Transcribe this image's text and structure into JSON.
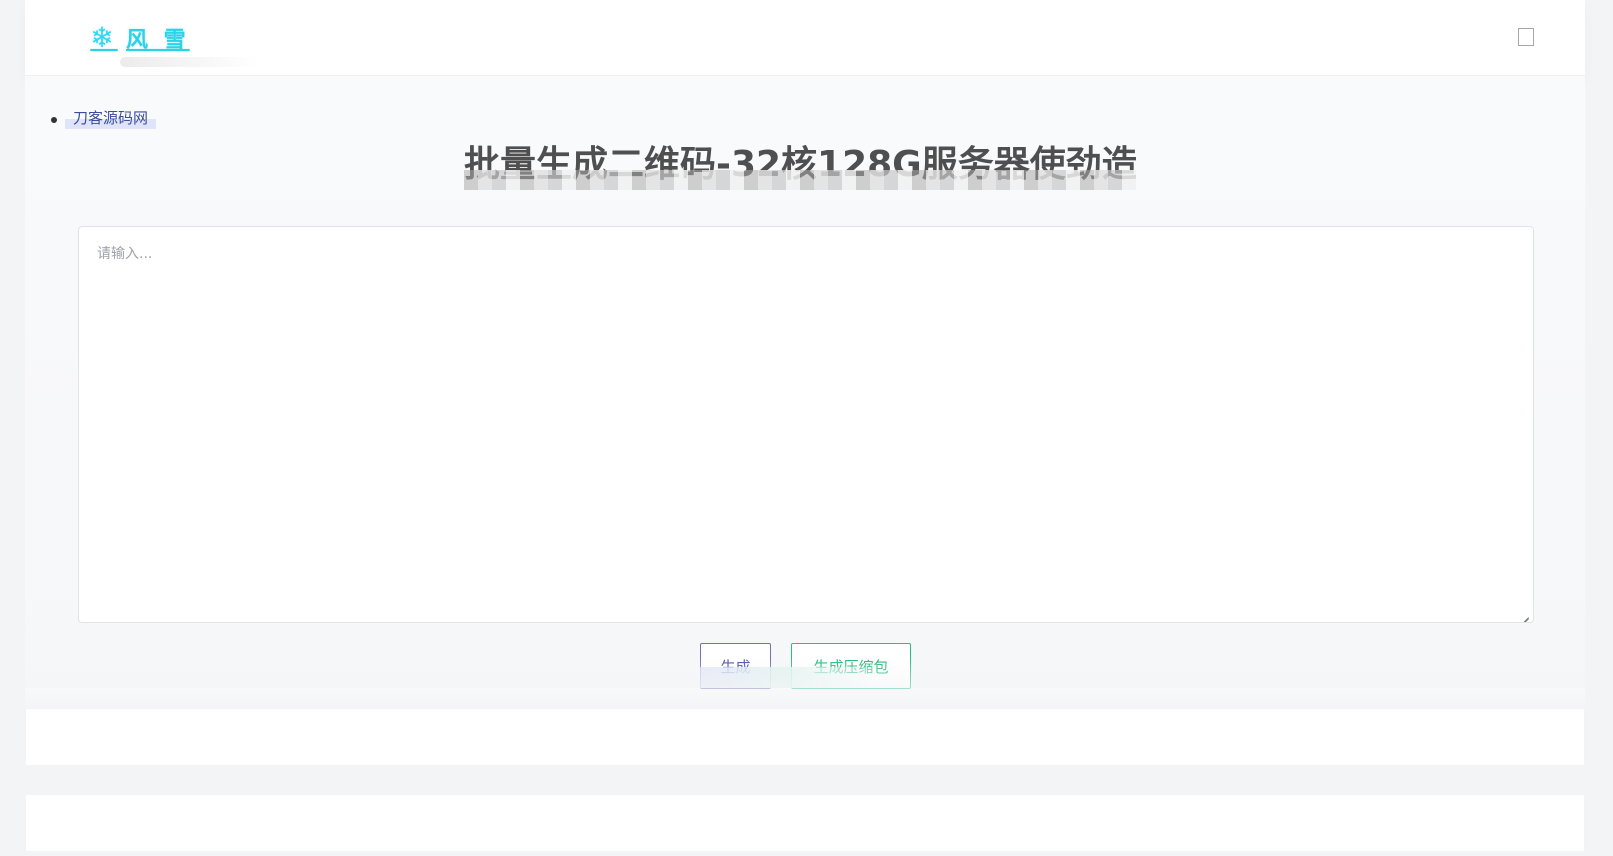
{
  "header": {
    "brand_text": "风 雪",
    "menu_icon": "menu-box-icon"
  },
  "breadcrumb": {
    "link_text": "刀客源码网"
  },
  "main": {
    "title": "批量生成二维码-32核128G服务器使劲造",
    "textarea_placeholder": "请输入..."
  },
  "actions": {
    "generate_label": "生成",
    "zip_label": "生成压缩包"
  },
  "colors": {
    "brand_cyan": "#2bd3e6",
    "primary_purple": "#4a50ad",
    "success_green": "#25b877"
  }
}
